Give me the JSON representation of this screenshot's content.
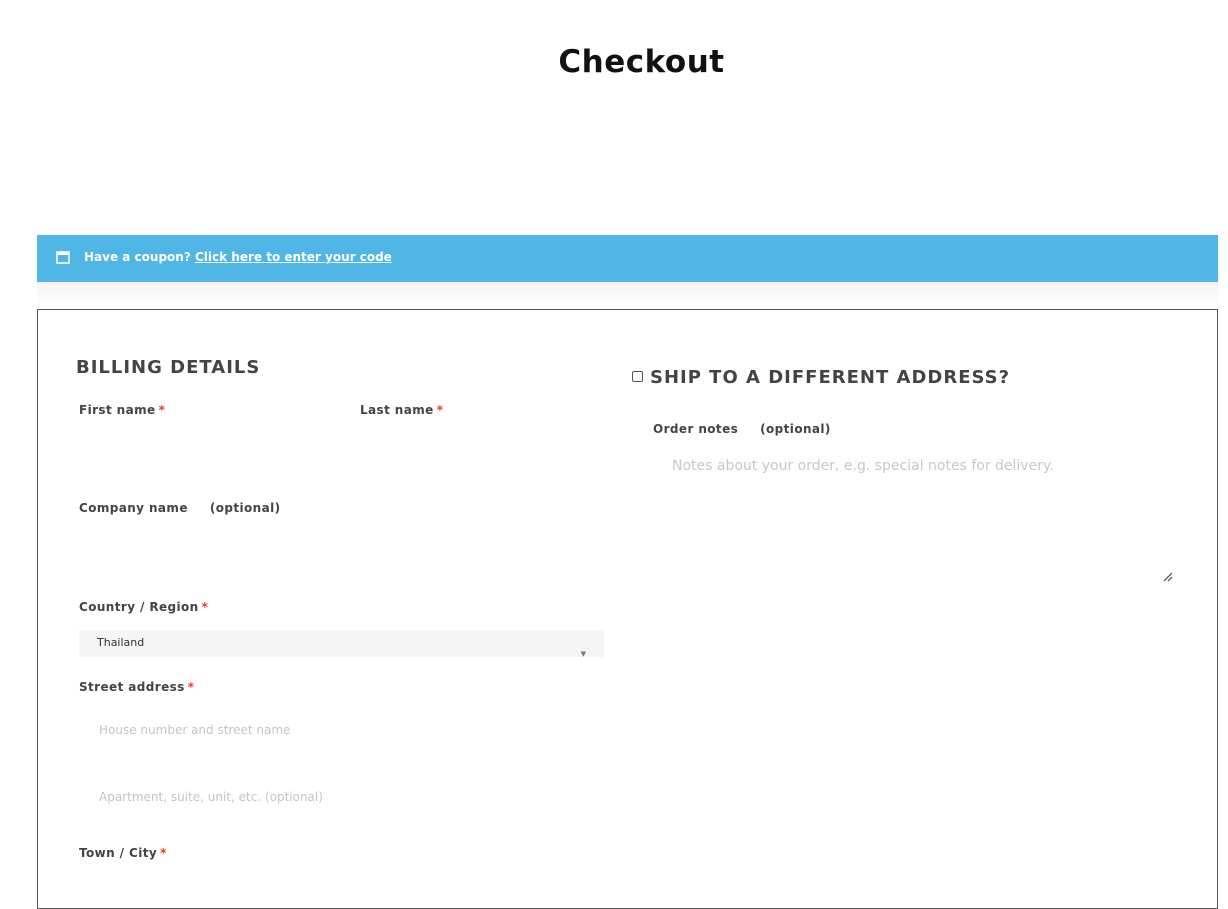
{
  "page": {
    "title": "Checkout"
  },
  "coupon": {
    "text": "Have a coupon?",
    "link": "Click here to enter your code",
    "icon": "calendar-icon",
    "background": "#4fb6e5"
  },
  "billing": {
    "heading": "BILLING DETAILS",
    "first_name": {
      "label": "First name",
      "required": "*",
      "value": ""
    },
    "last_name": {
      "label": "Last name",
      "required": "*",
      "value": ""
    },
    "company": {
      "label": "Company name",
      "optional": "(optional)",
      "value": ""
    },
    "country": {
      "label": "Country / Region",
      "required": "*",
      "selected": "Thailand"
    },
    "street": {
      "label": "Street address",
      "required": "*",
      "placeholder_1": "House number and street name",
      "placeholder_2": "Apartment, suite, unit, etc. (optional)"
    },
    "city": {
      "label": "Town / City",
      "required": "*"
    }
  },
  "shipping": {
    "heading": "SHIP TO A DIFFERENT ADDRESS?",
    "checked": false
  },
  "notes": {
    "label": "Order notes",
    "optional": "(optional)",
    "placeholder": "Notes about your order, e.g. special notes for delivery."
  },
  "colors": {
    "required": "#e2401c",
    "text": "#444444"
  }
}
